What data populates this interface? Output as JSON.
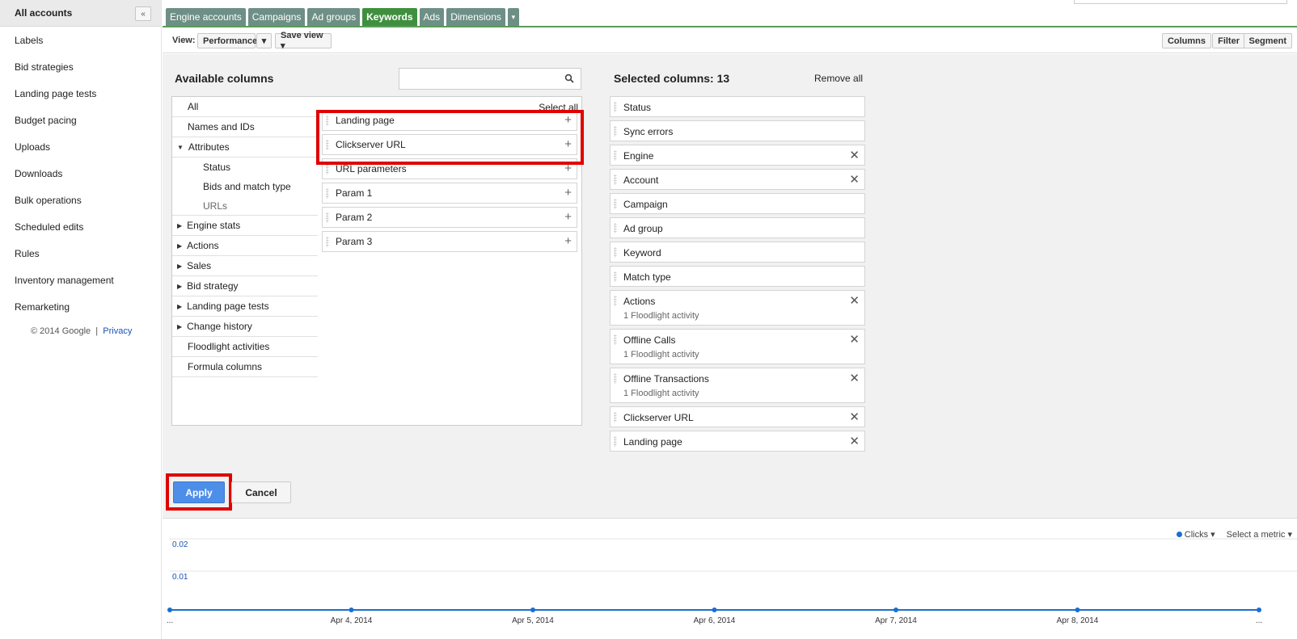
{
  "sidebar": {
    "title": "All accounts",
    "collapse_icon": "«",
    "items": [
      {
        "label": "Labels"
      },
      {
        "label": "Bid strategies"
      },
      {
        "label": "Landing page tests"
      },
      {
        "label": "Budget pacing"
      },
      {
        "label": "Uploads"
      },
      {
        "label": "Downloads"
      },
      {
        "label": "Bulk operations"
      },
      {
        "label": "Scheduled edits"
      },
      {
        "label": "Rules"
      },
      {
        "label": "Inventory management"
      },
      {
        "label": "Remarketing"
      }
    ],
    "footer_copyright": "© 2014 Google",
    "footer_sep": "|",
    "footer_privacy": "Privacy"
  },
  "tabs": [
    {
      "label": "Engine accounts"
    },
    {
      "label": "Campaigns"
    },
    {
      "label": "Ad groups"
    },
    {
      "label": "Keywords",
      "active": true
    },
    {
      "label": "Ads"
    },
    {
      "label": "Dimensions"
    }
  ],
  "tab_dropdown_icon": "▾",
  "toolbar": {
    "view_label": "View:",
    "view_value": "Performance",
    "dropdown_icon": "▾",
    "save_view": "Save view ▾",
    "columns": "Columns",
    "filter": "Filter",
    "segment": "Segment"
  },
  "available": {
    "title": "Available columns",
    "select_all": "Select all",
    "categories": [
      {
        "label": "All"
      },
      {
        "label": "Names and IDs"
      },
      {
        "label": "Attributes",
        "arrow": "▼"
      },
      {
        "label": "Status",
        "sub": true
      },
      {
        "label": "Bids and match type",
        "sub": true
      },
      {
        "label": "URLs",
        "sub": true,
        "selected": true
      },
      {
        "label": "Engine stats",
        "arrow": "▶"
      },
      {
        "label": "Actions",
        "arrow": "▶"
      },
      {
        "label": "Sales",
        "arrow": "▶"
      },
      {
        "label": "Bid strategy",
        "arrow": "▶"
      },
      {
        "label": "Landing page tests",
        "arrow": "▶"
      },
      {
        "label": "Change history",
        "arrow": "▶"
      },
      {
        "label": "Floodlight activities"
      },
      {
        "label": "Formula columns"
      }
    ],
    "options": [
      {
        "label": "Landing page"
      },
      {
        "label": "Clickserver URL"
      },
      {
        "label": "URL parameters"
      },
      {
        "label": "Param 1"
      },
      {
        "label": "Param 2"
      },
      {
        "label": "Param 3"
      }
    ],
    "plus_icon": "+"
  },
  "selected": {
    "title": "Selected columns: 13",
    "remove_all": "Remove all",
    "remove_icon": "✕",
    "columns": [
      {
        "label": "Status",
        "removable": false
      },
      {
        "label": "Sync errors",
        "removable": false
      },
      {
        "label": "Engine",
        "removable": true
      },
      {
        "label": "Account",
        "removable": true
      },
      {
        "label": "Campaign",
        "removable": false
      },
      {
        "label": "Ad group",
        "removable": false
      },
      {
        "label": "Keyword",
        "removable": false
      },
      {
        "label": "Match type",
        "removable": false
      },
      {
        "label": "Actions",
        "sub": "1 Floodlight activity",
        "removable": true
      },
      {
        "label": "Offline Calls",
        "sub": "1 Floodlight activity",
        "removable": true
      },
      {
        "label": "Offline Transactions",
        "sub": "1 Floodlight activity",
        "removable": true
      },
      {
        "label": "Clickserver URL",
        "removable": true
      },
      {
        "label": "Landing page",
        "removable": true
      }
    ]
  },
  "actions": {
    "apply": "Apply",
    "cancel": "Cancel"
  },
  "metric": {
    "primary": "Clicks ▾",
    "secondary": "Select a metric ▾",
    "series_color": "#1a6fd1"
  },
  "chart_data": {
    "type": "line",
    "x": [
      "...",
      "Apr 4, 2014",
      "Apr 5, 2014",
      "Apr 6, 2014",
      "Apr 7, 2014",
      "Apr 8, 2014",
      "..."
    ],
    "series": [
      {
        "name": "Clicks",
        "values": [
          0,
          0,
          0,
          0,
          0,
          0,
          0
        ]
      }
    ],
    "yticks": [
      "0.02",
      "0.01"
    ],
    "ylim": [
      0,
      0.02
    ],
    "grid": true
  }
}
